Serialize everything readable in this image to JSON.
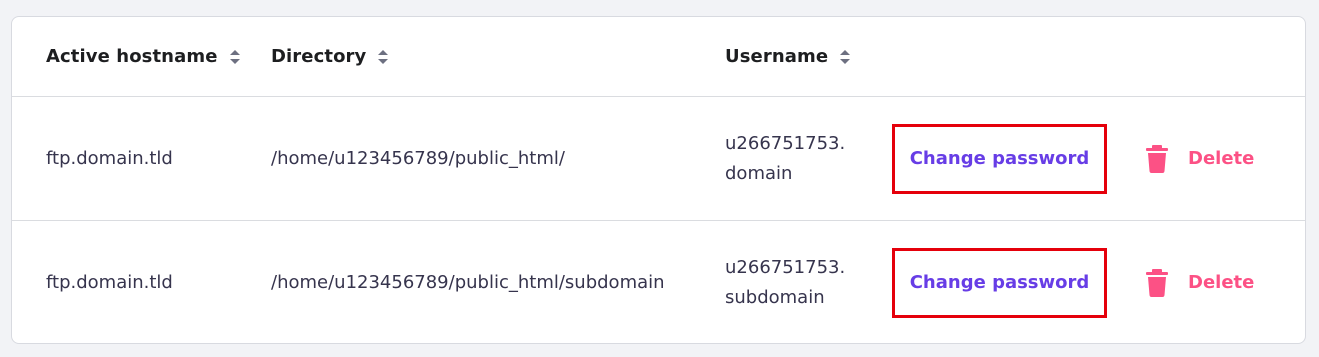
{
  "table": {
    "headers": {
      "host": "Active hostname",
      "directory": "Directory",
      "username": "Username"
    },
    "rows": [
      {
        "host": "ftp.domain.tld",
        "directory": "/home/u123456789/public_html/",
        "username_line1": "u266751753.",
        "username_line2": "domain",
        "change_label": "Change password",
        "delete_label": "Delete"
      },
      {
        "host": "ftp.domain.tld",
        "directory": "/home/u123456789/public_html/subdomain",
        "username_line1": "u266751753.",
        "username_line2": "subdomain",
        "change_label": "Change password",
        "delete_label": "Delete"
      }
    ]
  },
  "icons": {
    "sort": "sort-icon",
    "trash": "trash-icon"
  },
  "colors": {
    "primary": "#673de6",
    "danger": "#fc5185",
    "highlight_border": "#e5000b",
    "header_text": "#1d1e20",
    "body_text": "#36344d"
  }
}
